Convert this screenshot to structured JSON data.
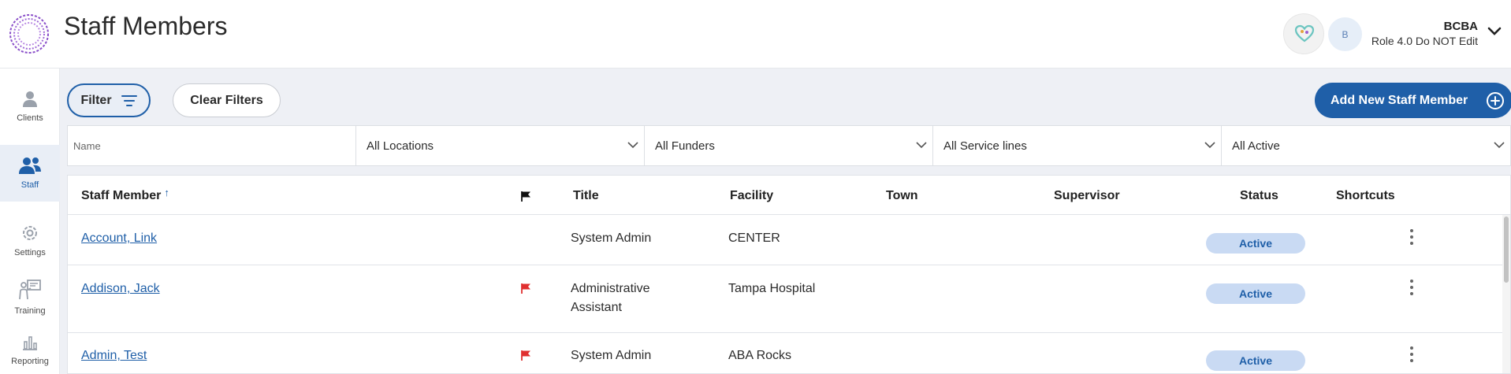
{
  "header": {
    "title": "Staff Members",
    "user_name": "BCBA",
    "user_role": "Role 4.0 Do NOT Edit",
    "avatar_initial": "B"
  },
  "sidebar": {
    "items": [
      {
        "label": "Clients",
        "icon": "person-icon"
      },
      {
        "label": "Staff",
        "icon": "people-icon",
        "active": true
      },
      {
        "label": "Settings",
        "icon": "gear-icon"
      },
      {
        "label": "Training",
        "icon": "training-icon"
      },
      {
        "label": "Reporting",
        "icon": "bar-chart-icon"
      }
    ]
  },
  "toolbar": {
    "filter_label": "Filter",
    "clear_label": "Clear Filters",
    "add_label": "Add New Staff Member"
  },
  "filters": {
    "name_placeholder": "Name",
    "locations": "All Locations",
    "funders": "All Funders",
    "service_lines": "All Service lines",
    "active": "All Active"
  },
  "table": {
    "columns": {
      "staff_member": "Staff Member",
      "title": "Title",
      "facility": "Facility",
      "town": "Town",
      "supervisor": "Supervisor",
      "status": "Status",
      "shortcuts": "Shortcuts"
    },
    "rows": [
      {
        "name": "Account, Link",
        "flagged": false,
        "title": "System Admin",
        "facility": "CENTER",
        "town": "",
        "supervisor": "",
        "status": "Active"
      },
      {
        "name": "Addison, Jack",
        "flagged": true,
        "title_line1": "Administrative",
        "title_line2": "Assistant",
        "facility": "Tampa Hospital",
        "town": "",
        "supervisor": "",
        "status": "Active"
      },
      {
        "name": "Admin, Test",
        "flagged": true,
        "title": "System Admin",
        "facility": "ABA Rocks",
        "town": "",
        "supervisor": "",
        "status": "Active"
      }
    ]
  },
  "colors": {
    "primary": "#1f5fa8",
    "status_bg": "#c9daf3",
    "flag_red": "#e03030",
    "content_bg": "#eef0f5"
  }
}
